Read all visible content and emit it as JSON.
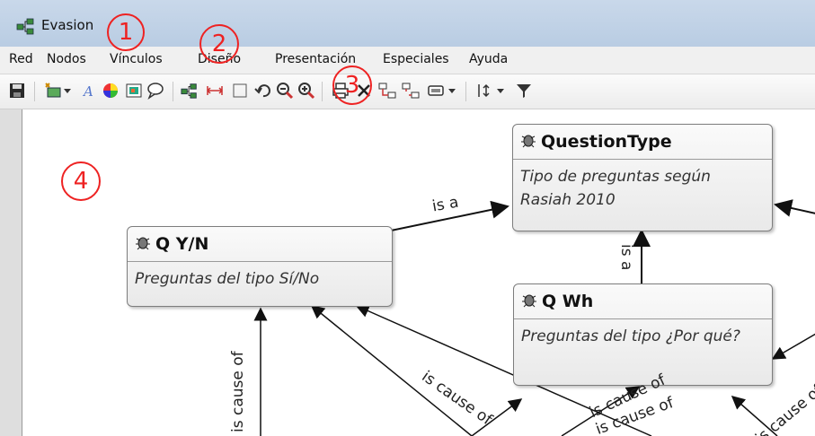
{
  "window": {
    "title": "Evasion"
  },
  "menu": [
    "Red",
    "Nodos",
    "Vínculos",
    "Diseño",
    "Presentación",
    "Especiales",
    "Ayuda"
  ],
  "toolbar_icons": [
    "save-icon",
    "add-node-icon",
    "dropdown-arrow-icon",
    "text-style-icon",
    "color-wheel-icon",
    "image-icon",
    "comment-icon",
    "network-icon",
    "width-icon",
    "layout-icon",
    "undo-icon",
    "zoom-out-icon",
    "zoom-in-icon",
    "print-icon",
    "delete-icon",
    "link-icon",
    "unlink-icon",
    "view-icon",
    "dropdown-arrow-icon",
    "spacing-icon",
    "dropdown-arrow-icon",
    "filter-icon"
  ],
  "markers": {
    "m1": "1",
    "m2": "2",
    "m3": "3",
    "m4": "4"
  },
  "nodes": {
    "question_type": {
      "title": "QuestionType",
      "desc": "Tipo de preguntas según Rasiah 2010"
    },
    "q_yn": {
      "title": "Q Y/N",
      "desc": "Preguntas del tipo Sí/No"
    },
    "q_wh": {
      "title": "Q Wh",
      "desc": "Preguntas del tipo ¿Por qué?"
    }
  },
  "edges": {
    "is_a_1": "is a",
    "is_a_2": "is a",
    "cause_of": "is cause of",
    "cause_1": "is cause of",
    "cause_2": "is cause of",
    "cause_3": "is cause of",
    "cause_4": "is cause of"
  }
}
